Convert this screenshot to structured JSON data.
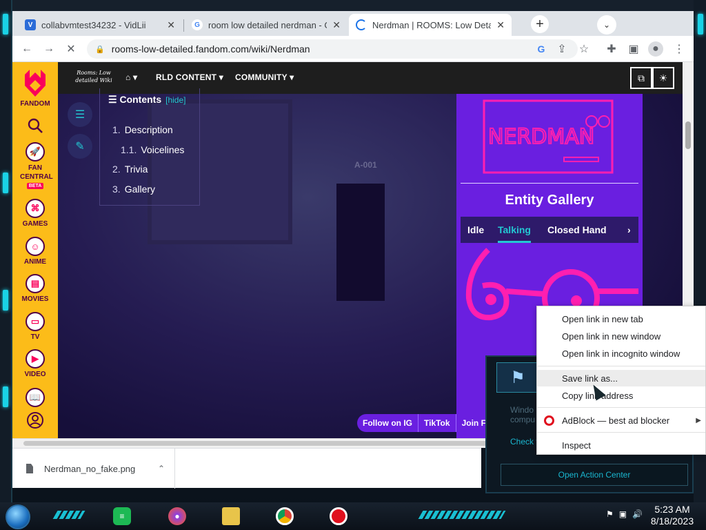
{
  "browser": {
    "tabs": [
      {
        "label": "collabvmtest34232 - VidLii",
        "icon": "vidlii-icon"
      },
      {
        "label": "room low detailed nerdman - Go",
        "icon": "google-icon"
      },
      {
        "label": "Nerdman | ROOMS: Low Detailed",
        "icon": "loading-spinner-icon"
      }
    ],
    "url": "rooms-low-detailed.fandom.com/wiki/Nerdman",
    "new_tab_symbol": "+",
    "tab_menu_symbol": "⌄"
  },
  "fandom": {
    "sidebar": [
      {
        "label": "FANDOM",
        "icon": "fandom-heart-icon"
      },
      {
        "label": "",
        "icon": "search-icon"
      },
      {
        "label": "FAN CENTRAL",
        "icon": "rocket-icon",
        "badge": "BETA"
      },
      {
        "label": "GAMES",
        "icon": "gamepad-icon"
      },
      {
        "label": "ANIME",
        "icon": "anime-face-icon"
      },
      {
        "label": "MOVIES",
        "icon": "clapperboard-icon"
      },
      {
        "label": "TV",
        "icon": "tv-icon"
      },
      {
        "label": "VIDEO",
        "icon": "play-icon"
      },
      {
        "label": "",
        "icon": "book-icon"
      },
      {
        "label": "",
        "icon": "user-icon"
      }
    ],
    "wiki_wordmark": "Rooms: Low detailed Wiki",
    "nav": [
      "RLD CONTENT",
      "COMMUNITY"
    ],
    "toc": {
      "title": "Contents",
      "hide": "[hide]",
      "items": [
        {
          "num": "1.",
          "label": "Description"
        },
        {
          "num": "1.1.",
          "label": "Voicelines"
        },
        {
          "num": "2.",
          "label": "Trivia"
        },
        {
          "num": "3.",
          "label": "Gallery"
        }
      ]
    },
    "room_sign": "A-001",
    "infobox": {
      "image_text": "NERDMAN",
      "title": "Entity Gallery",
      "tabs": [
        "Idle",
        "Talking",
        "Closed Hand"
      ],
      "active_tab": "Talking"
    },
    "social": [
      "Follow on IG",
      "TikTok",
      "Join F"
    ]
  },
  "download": {
    "filename": "Nerdman_no_fake.png"
  },
  "toast": {
    "text_line1": "Windo",
    "text_line2": "compu",
    "link": "Check f",
    "open_action_center": "Open Action Center"
  },
  "context_menu": [
    {
      "label": "Open link in new tab"
    },
    {
      "label": "Open link in new window"
    },
    {
      "label": "Open link in incognito window"
    },
    {
      "label": "Save link as..."
    },
    {
      "label": "Copy link address"
    },
    {
      "label": "AdBlock — best ad blocker"
    },
    {
      "label": "Inspect"
    }
  ],
  "taskbar": {
    "time": "5:23 AM",
    "date": "8/18/2023"
  },
  "colors": {
    "fandom_yellow": "#fcbc19",
    "fandom_header": "#1e1e1e",
    "infobox_purple": "#6a1fe0",
    "accent_teal": "#23c8d2",
    "nerdman_pink": "#ff1fb0",
    "frame_cyan": "#1ad2e6"
  }
}
